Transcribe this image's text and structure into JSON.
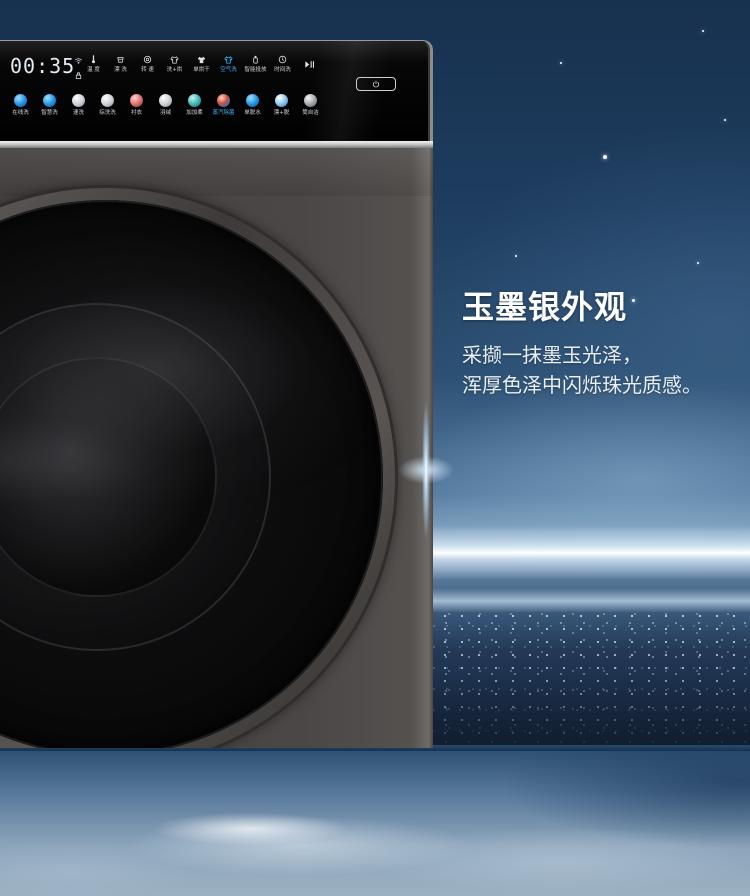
{
  "headline": {
    "title": "玉墨银外观",
    "line1": "采撷一抹墨玉光泽，",
    "line2": "浑厚色泽中闪烁珠光质感。"
  },
  "control_panel": {
    "display_time": "00:35",
    "status_icons": [
      "wifi-icon",
      "lock-icon"
    ],
    "function_keys": [
      {
        "label": "温 度",
        "icon": "thermometer-icon"
      },
      {
        "label": "漂 洗",
        "icon": "rinse-icon"
      },
      {
        "label": "转 速",
        "icon": "spin-icon"
      },
      {
        "label": "洗+烘",
        "icon": "wash-dry-icon"
      },
      {
        "label": "单烘干",
        "icon": "dry-icon"
      },
      {
        "label": "空气洗",
        "icon": "air-wash-icon",
        "active": true
      },
      {
        "label": "智能投放",
        "icon": "auto-dose-icon"
      },
      {
        "label": "时间洗",
        "icon": "timer-icon"
      },
      {
        "icon": "play-pause-icon"
      }
    ],
    "programs": [
      {
        "label": "在线洗",
        "icon": "online-wash-icon"
      },
      {
        "label": "智慧洗",
        "icon": "smart-wash-icon"
      },
      {
        "label": "速洗",
        "icon": "quick-wash-icon"
      },
      {
        "label": "综洗洗",
        "icon": "mixed-wash-icon"
      },
      {
        "label": "衬衣",
        "icon": "shirt-icon"
      },
      {
        "label": "羽绒",
        "icon": "down-jacket-icon"
      },
      {
        "label": "加加柔",
        "icon": "softener-icon"
      },
      {
        "label": "蒸汽除菌",
        "icon": "steam-sterilize-icon",
        "active": true
      },
      {
        "label": "单脱水",
        "icon": "spin-dry-icon"
      },
      {
        "label": "漂+脱",
        "icon": "rinse-spin-icon"
      },
      {
        "label": "筒自洁",
        "icon": "drum-clean-icon"
      }
    ],
    "power_icon": "power-icon"
  },
  "colors": {
    "accent_active": "#3cb4ff",
    "machine_body": "#4b4746",
    "control_panel": "#050505",
    "sky_top": "#17314e",
    "headline_text": "#ffffff"
  }
}
